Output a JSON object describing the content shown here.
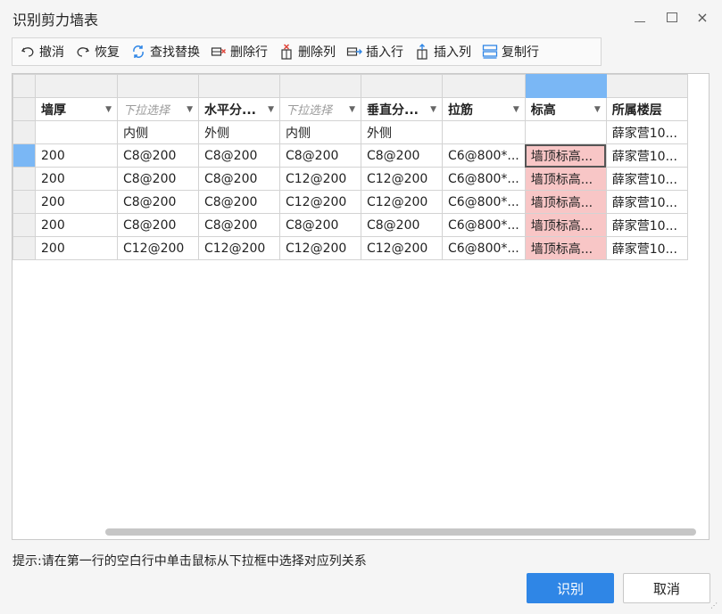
{
  "window": {
    "title": "识别剪力墙表",
    "minimize": "minimize",
    "maximize": "maximize",
    "close": "×"
  },
  "toolbar": {
    "undo": "撤消",
    "redo": "恢复",
    "find_replace": "查找替换",
    "delete_row": "删除行",
    "delete_col": "删除列",
    "insert_row": "插入行",
    "insert_col": "插入列",
    "copy_row": "复制行"
  },
  "grid": {
    "headers": [
      {
        "label": "墙厚",
        "placeholder": false
      },
      {
        "label": "下拉选择",
        "placeholder": true
      },
      {
        "label": "水平分...",
        "placeholder": false
      },
      {
        "label": "下拉选择",
        "placeholder": true
      },
      {
        "label": "垂直分...",
        "placeholder": false
      },
      {
        "label": "拉筋",
        "placeholder": false
      },
      {
        "label": "标高",
        "placeholder": false
      },
      {
        "label": "所属楼层",
        "placeholder": false
      }
    ],
    "subheader": [
      "",
      "内侧",
      "外侧",
      "内侧",
      "外侧",
      "",
      "",
      "薛家营10..."
    ],
    "rows": [
      [
        "200",
        "C8@200",
        "C8@200",
        "C8@200",
        "C8@200",
        "C6@800*...",
        "墙顶标高...",
        "薛家营10..."
      ],
      [
        "200",
        "C8@200",
        "C8@200",
        "C12@200",
        "C12@200",
        "C6@800*...",
        "墙顶标高...",
        "薛家营10..."
      ],
      [
        "200",
        "C8@200",
        "C8@200",
        "C12@200",
        "C12@200",
        "C6@800*...",
        "墙顶标高...",
        "薛家营10..."
      ],
      [
        "200",
        "C8@200",
        "C8@200",
        "C8@200",
        "C8@200",
        "C6@800*...",
        "墙顶标高...",
        "薛家营10..."
      ],
      [
        "200",
        "C12@200",
        "C12@200",
        "C12@200",
        "C12@200",
        "C6@800*...",
        "墙顶标高...",
        "薛家营10..."
      ]
    ]
  },
  "hint": "提示:请在第一行的空白行中单击鼠标从下拉框中选择对应列关系",
  "buttons": {
    "ok": "识别",
    "cancel": "取消"
  },
  "colors": {
    "accent": "#2f86e6",
    "selected_header": "#7ab7f5",
    "highlight_cell": "#f8c6c6"
  }
}
